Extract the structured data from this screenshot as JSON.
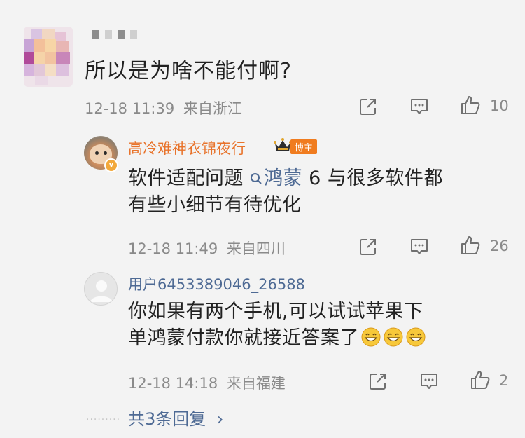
{
  "main_comment": {
    "username": "",
    "text": "所以是为啥不能付啊?",
    "date": "12-18 11:39",
    "location": "来自浙江",
    "like_count": "10"
  },
  "replies": [
    {
      "author": "高冷难神衣锦夜行",
      "badge": "博主",
      "text_before": "软件适配问题 ",
      "topic": "鸿蒙",
      "text_after": " 6 与很多软件都",
      "text_line2": "有些小细节有待优化",
      "date": "12-18 11:49",
      "location": "来自四川",
      "like_count": "26"
    },
    {
      "author": "用户6453389046_26588",
      "text_line1": "你如果有两个手机,可以试试苹果下",
      "text_line2": "单鸿蒙付款你就接近答案了",
      "date": "12-18 14:18",
      "location": "来自福建",
      "like_count": "2"
    }
  ],
  "more_replies_label": "共3条回复",
  "more_replies_arrow": "›",
  "icons": [
    "share-icon",
    "comment-icon",
    "like-icon",
    "crown-icon",
    "search-icon",
    "grin-emoji-icon"
  ],
  "colors": {
    "link": "#4e6a94",
    "blogger_name": "#e8732b",
    "badge_bg": "#f07c1f",
    "meta": "#8a8a8a",
    "background": "#f3f3f3"
  }
}
